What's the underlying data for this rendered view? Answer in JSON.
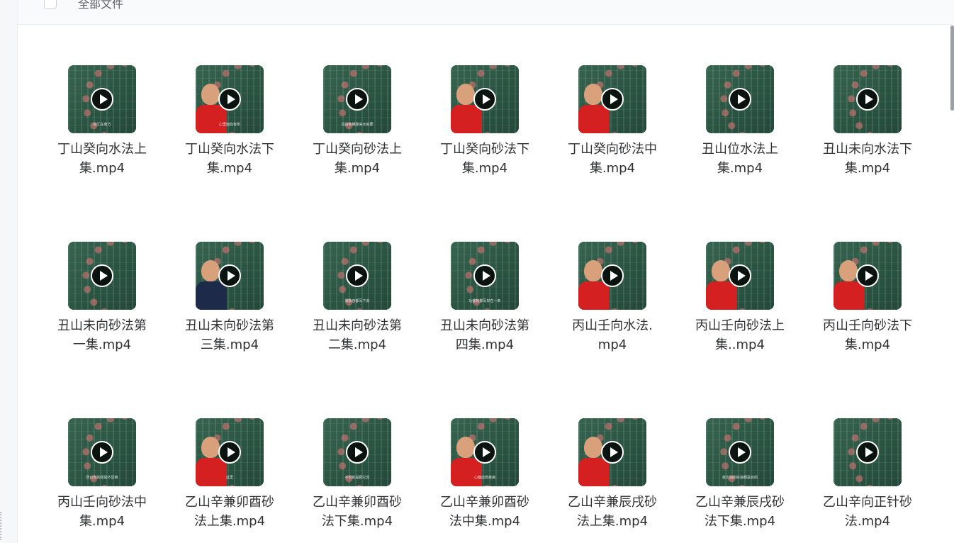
{
  "header": {
    "title": "全部文件"
  },
  "files": [
    {
      "name": "丁山癸向水法上集.mp4",
      "caption": "如汇在南方",
      "style": "board"
    },
    {
      "name": "丁山癸向水法下集.mp4",
      "caption": "心里面自有所",
      "style": "person"
    },
    {
      "name": "丁山癸向砂法上集.mp4",
      "caption": "且四条横脉来水就要",
      "style": "board"
    },
    {
      "name": "丁山癸向砂法下集.mp4",
      "caption": "",
      "style": "person"
    },
    {
      "name": "丁山癸向砂法中集.mp4",
      "caption": "",
      "style": "person"
    },
    {
      "name": "丑山位水法上集.mp4",
      "caption": "",
      "style": "board"
    },
    {
      "name": "丑山未向水法下集.mp4",
      "caption": "",
      "style": "board"
    },
    {
      "name": "丑山未向砂法第一集.mp4",
      "caption": "",
      "style": "board"
    },
    {
      "name": "丑山未向砂法第三集.mp4",
      "caption": "",
      "style": "suit"
    },
    {
      "name": "丑山未向砂法第二集.mp4",
      "caption": "剩脉自都写下去",
      "style": "board"
    },
    {
      "name": "丑山未向砂法第四集.mp4",
      "caption": "功能的都写好在一条",
      "style": "board"
    },
    {
      "name": "丙山壬向水法.mp4",
      "caption": "",
      "style": "person"
    },
    {
      "name": "丙山壬向砂法上集..mp4",
      "caption": "",
      "style": "person"
    },
    {
      "name": "丙山壬向砂法下集.mp4",
      "caption": "",
      "style": "person"
    },
    {
      "name": "丙山壬向砂法中集.mp4",
      "caption": "所以你的经验不足够",
      "style": "board"
    },
    {
      "name": "乙山辛兼卯酉砂法上集.mp4",
      "caption": "这里",
      "style": "person"
    },
    {
      "name": "乙山辛兼卯酉砂法下集.mp4",
      "caption": "不然就是把它吉",
      "style": "board"
    },
    {
      "name": "乙山辛兼卯酉砂法中集.mp4",
      "caption": "心脑血管疾病",
      "style": "person"
    },
    {
      "name": "乙山辛兼辰戌砂法上集.mp4",
      "caption": "",
      "style": "person"
    },
    {
      "name": "乙山辛兼辰戌砂法下集.mp4",
      "caption": "就比如的好窗都是目的",
      "style": "board"
    },
    {
      "name": "乙山辛向正针砂法.mp4",
      "caption": "",
      "style": "board"
    }
  ]
}
